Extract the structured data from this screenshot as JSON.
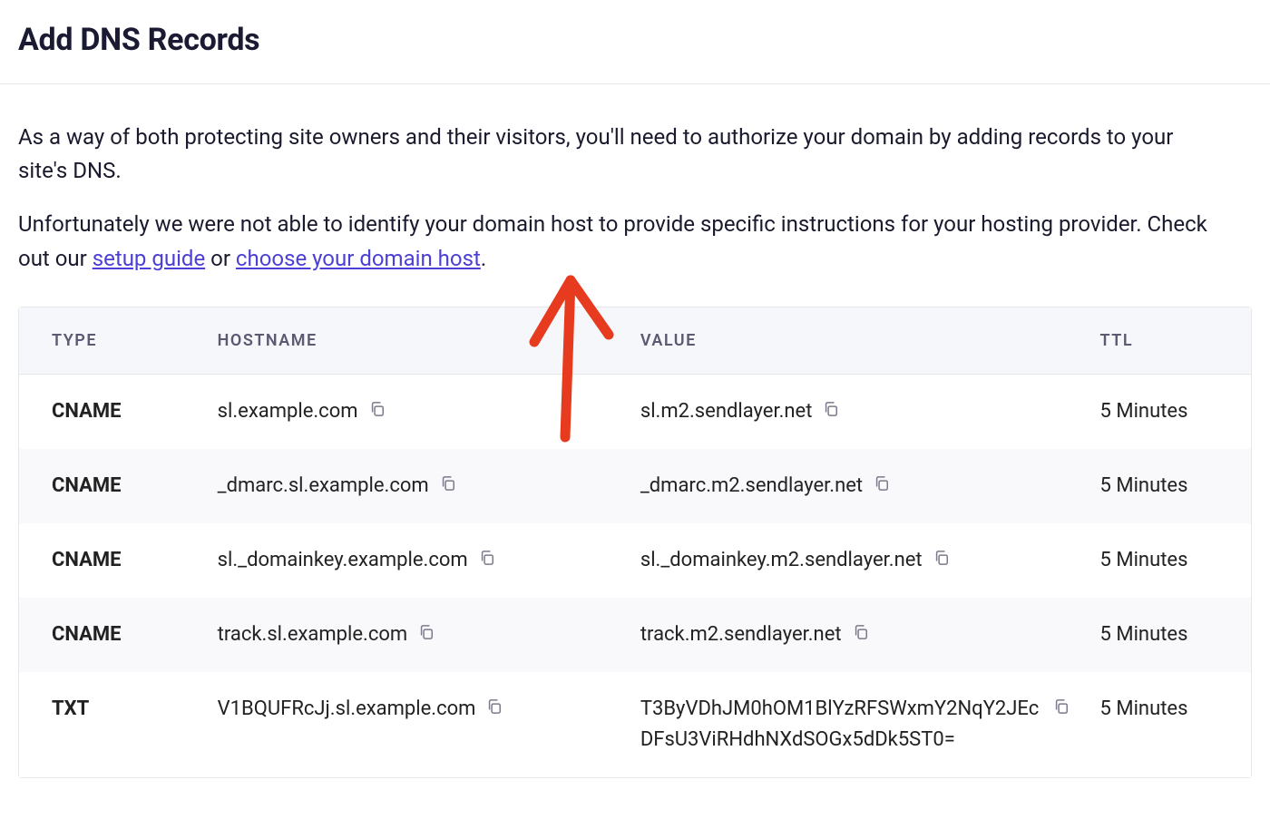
{
  "page_title": "Add DNS Records",
  "intro": {
    "paragraph1": "As a way of both protecting site owners and their visitors, you'll need to authorize your domain by adding records to your site's DNS.",
    "paragraph2_pre": "Unfortunately we were not able to identify your domain host to provide specific instructions for your hosting provider. Check out our ",
    "link1": "setup guide",
    "paragraph2_mid": " or ",
    "link2": "choose your domain host",
    "paragraph2_post": "."
  },
  "headers": {
    "type": "TYPE",
    "hostname": "HOSTNAME",
    "value": "VALUE",
    "ttl": "TTL"
  },
  "rows": [
    {
      "type": "CNAME",
      "hostname": "sl.example.com",
      "value": "sl.m2.sendlayer.net",
      "ttl": "5 Minutes"
    },
    {
      "type": "CNAME",
      "hostname": "_dmarc.sl.example.com",
      "value": "_dmarc.m2.sendlayer.net",
      "ttl": "5 Minutes"
    },
    {
      "type": "CNAME",
      "hostname": "sl._domainkey.example.com",
      "value": "sl._domainkey.m2.sendlayer.net",
      "ttl": "5 Minutes"
    },
    {
      "type": "CNAME",
      "hostname": "track.sl.example.com",
      "value": "track.m2.sendlayer.net",
      "ttl": "5 Minutes"
    },
    {
      "type": "TXT",
      "hostname": "V1BQUFRcJj.sl.example.com",
      "value": "T3ByVDhJM0hOM1BlYzRFSWxmY2NqY2JEcDFsU3ViRHdhNXdSOGx5dDk5ST0=",
      "ttl": "5 Minutes"
    }
  ]
}
